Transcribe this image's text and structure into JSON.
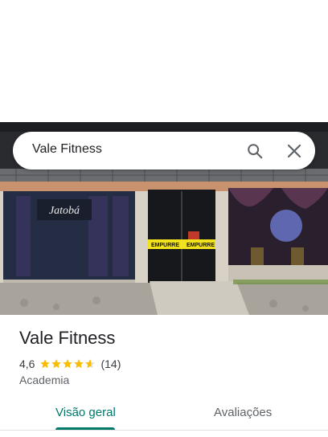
{
  "search": {
    "query": "Vale Fitness",
    "search_icon": "search-icon",
    "close_icon": "close-icon"
  },
  "photo": {
    "sign_text": "Jatobá",
    "tape_text": "EMPURRE"
  },
  "place": {
    "name": "Vale Fitness",
    "rating": "4,6",
    "stars": 4.6,
    "review_count": "(14)",
    "category": "Academia"
  },
  "tabs": [
    {
      "label": "Visão geral",
      "selected": true
    },
    {
      "label": "Avaliações",
      "selected": false
    }
  ],
  "colors": {
    "accent": "#00796b",
    "star": "#fbbc04"
  }
}
